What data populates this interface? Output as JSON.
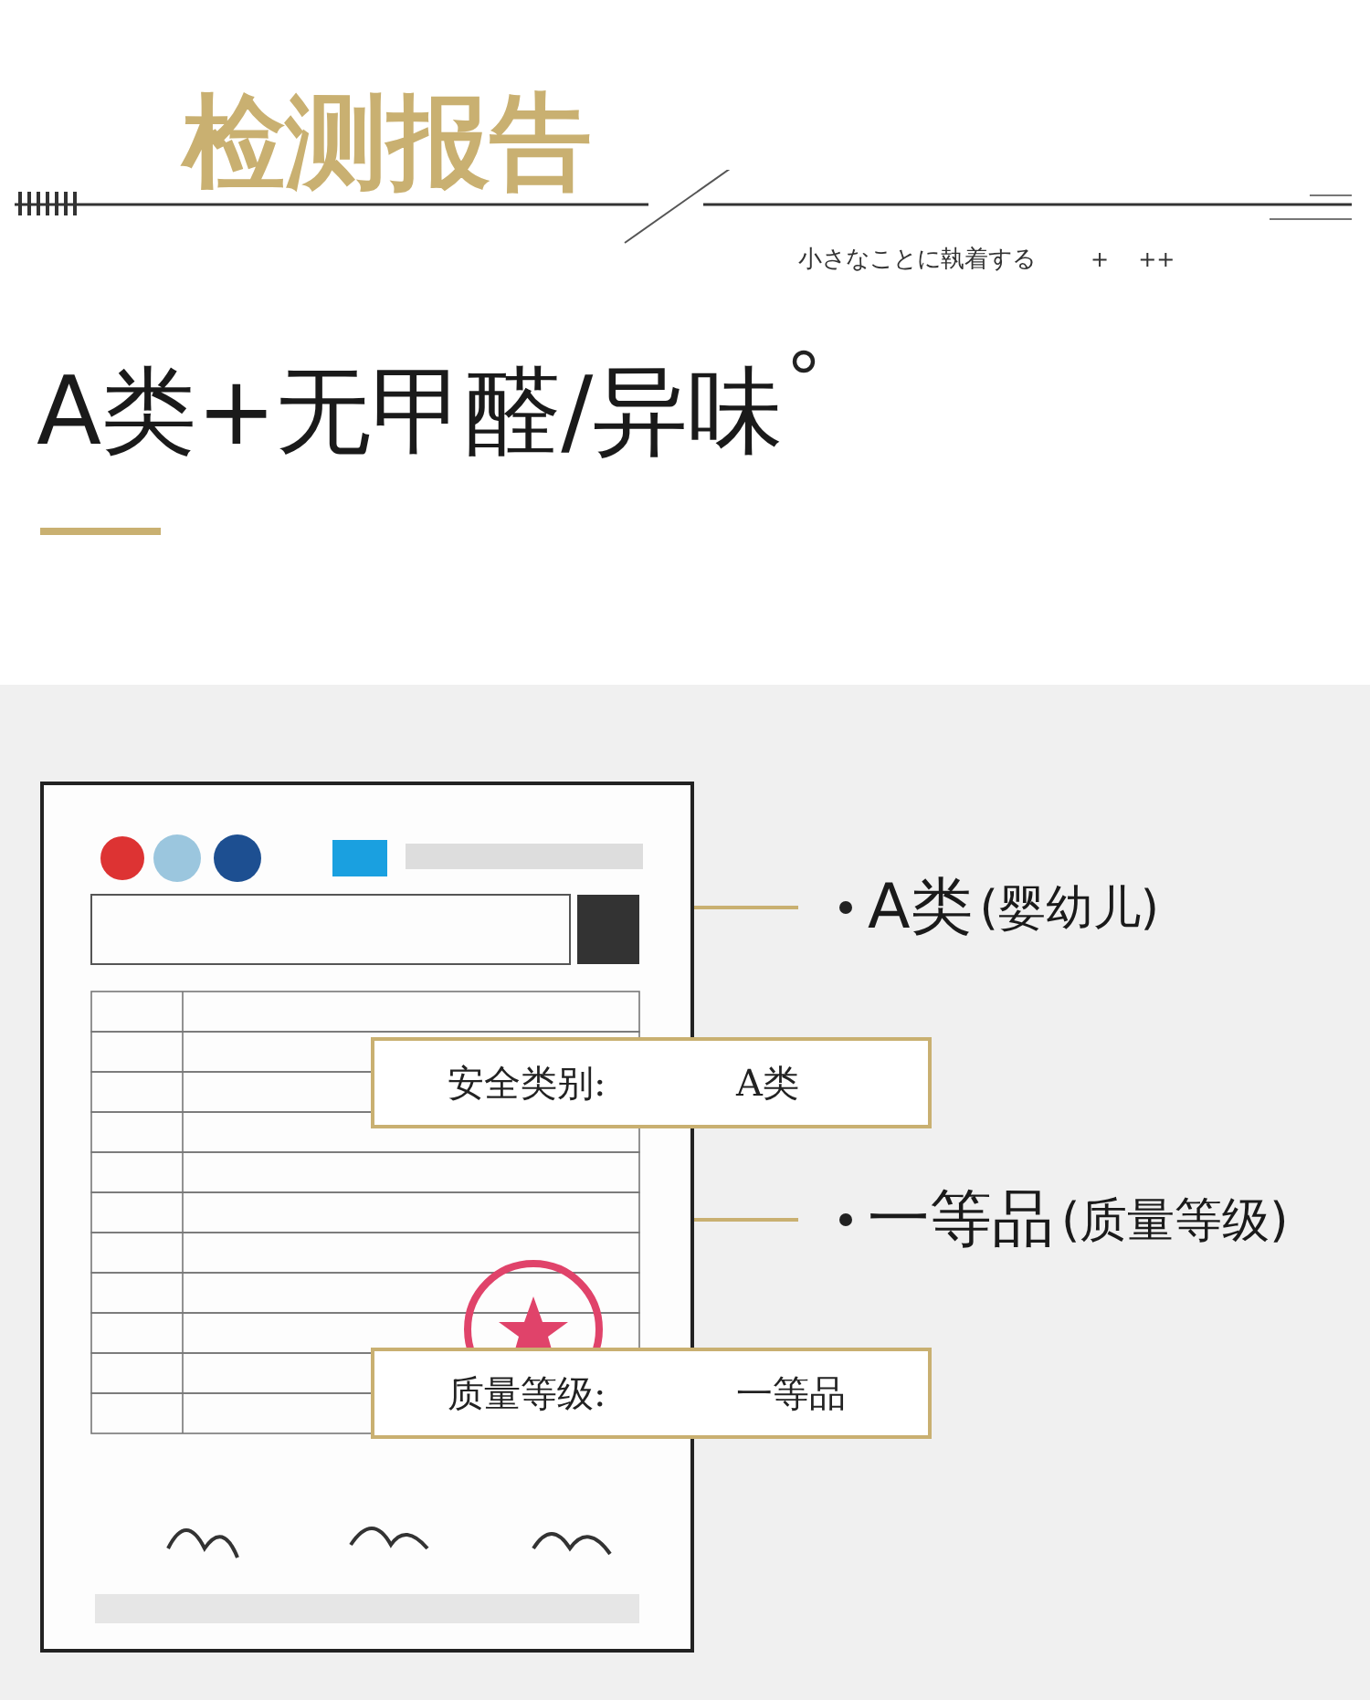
{
  "header": {
    "title": "检测报告",
    "tagline": "小さなことに執着する",
    "marks": [
      "+",
      "++"
    ]
  },
  "headline": "A类+无甲醛/异味",
  "callouts": [
    {
      "label": "安全类别:",
      "value": "A类"
    },
    {
      "label": "质量等级:",
      "value": "一等品"
    }
  ],
  "features": [
    {
      "main": "A类",
      "note": "(婴幼儿)"
    },
    {
      "main": "一等品",
      "note": "(质量等级)"
    }
  ]
}
